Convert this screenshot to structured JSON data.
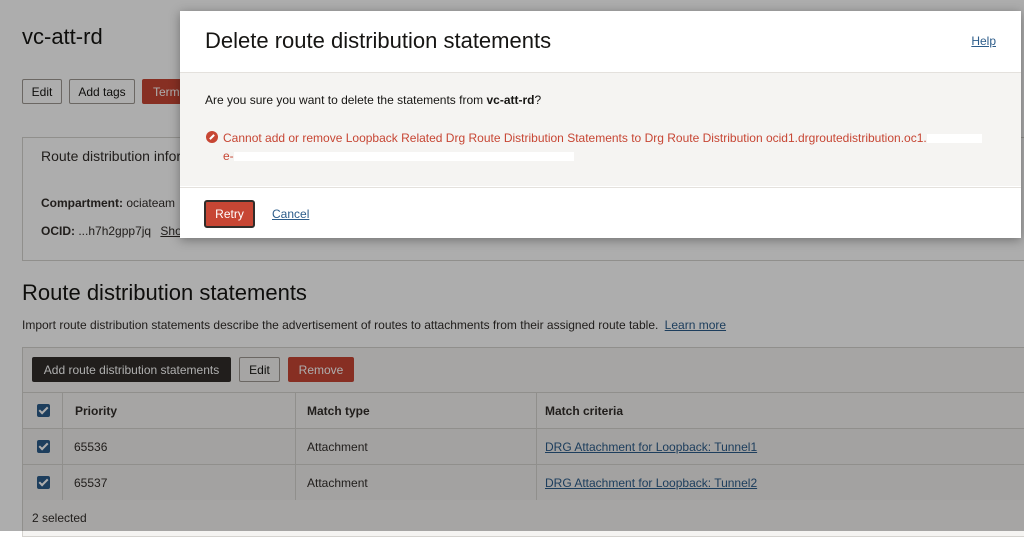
{
  "page": {
    "title": "vc-att-rd",
    "buttons": {
      "edit": "Edit",
      "add_tags": "Add tags",
      "terminate": "Term"
    },
    "info": {
      "heading": "Route distribution infor",
      "compartment_label": "Compartment:",
      "compartment_value": "ociateam",
      "ocid_label": "OCID:",
      "ocid_value": "...h7h2gpp7jq",
      "ocid_show": "Sho"
    },
    "statements": {
      "title": "Route distribution statements",
      "description": "Import route distribution statements describe the advertisement of routes to attachments from their assigned route table.",
      "learn_more": "Learn more",
      "add_button": "Add route distribution statements",
      "edit_button": "Edit",
      "remove_button": "Remove",
      "columns": [
        "Priority",
        "Match type",
        "Match criteria"
      ],
      "rows": [
        {
          "priority": "65536",
          "match_type": "Attachment",
          "criteria": "DRG Attachment for Loopback: Tunnel1"
        },
        {
          "priority": "65537",
          "match_type": "Attachment",
          "criteria": "DRG Attachment for Loopback: Tunnel2"
        }
      ],
      "selected_count": "2 selected"
    }
  },
  "dialog": {
    "title": "Delete route distribution statements",
    "help": "Help",
    "question_prefix": "Are you sure you want to delete the statements from ",
    "question_target": "vc-att-rd",
    "question_suffix": "?",
    "error_line1": "Cannot add or remove Loopback Related Drg Route Distribution Statements to Drg Route Distribution ocid1.drgroutedistribution.oc1.",
    "error_line2_prefix": "e-",
    "retry": "Retry",
    "cancel": "Cancel"
  },
  "icons": {
    "error": "error-circle-icon",
    "checkbox": "checkbox-checked-icon"
  },
  "colors": {
    "accent_red": "#c74634",
    "link_blue": "#2c5c8a",
    "dark_button": "#312d2a"
  }
}
